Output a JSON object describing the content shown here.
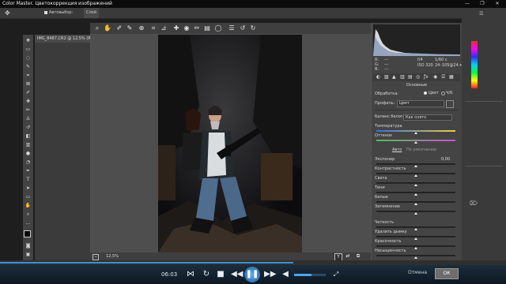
{
  "window": {
    "title": "Color Master. Цветокоррекция изображений",
    "controls": [
      "—",
      "❐",
      "✕"
    ]
  },
  "optbar": {
    "items": [
      "Автовыбор:",
      "Слой"
    ]
  },
  "doc_tab": {
    "label": "IMG_8487.CR2 @ 12,5% (RGB/8)"
  },
  "dialog": {
    "zoom": "12,5%",
    "toolbar_icons": [
      "zoom-icon",
      "hand-icon",
      "white-balance-icon",
      "color-sampler-icon",
      "target-adjust-icon",
      "crop-icon",
      "straighten-icon",
      "spot-removal-icon",
      "redeye-icon",
      "adjustment-brush-icon",
      "graduated-filter-icon",
      "radial-filter-icon",
      "preferences-icon",
      "rotate-ccw-icon",
      "rotate-cw-icon"
    ],
    "histogram_info": {
      "r": "R:",
      "g": "G:",
      "b": "B:",
      "dash": "---",
      "aperture": "f/4",
      "shutter": "1/60 с",
      "iso": "ISO 320",
      "lens": "24–105@24 мм"
    },
    "panel_title": "Основные",
    "processing_label": "Обработка:",
    "processing_color": "Цвет",
    "processing_bw": "Ч/Б",
    "profile_label": "Профиль:",
    "profile_value": "Цвет",
    "wb_label": "Баланс белого:",
    "wb_value": "Как снято",
    "sliders": [
      {
        "label": "Температура",
        "value": "",
        "pos": 0.5
      },
      {
        "label": "Оттенок",
        "value": "",
        "pos": 0.5
      },
      {
        "label": "Экспонир",
        "value": "0,00",
        "pos": 0.5
      },
      {
        "label": "Контрастность",
        "value": "",
        "pos": 0.5
      },
      {
        "label": "Света",
        "value": "",
        "pos": 0.5
      },
      {
        "label": "Тени",
        "value": "",
        "pos": 0.5
      },
      {
        "label": "Белые",
        "value": "",
        "pos": 0.5
      },
      {
        "label": "Затемнение",
        "value": "",
        "pos": 0.5
      },
      {
        "label": "Четкость",
        "value": "",
        "pos": 0.5
      },
      {
        "label": "Удалить дымку",
        "value": "",
        "pos": 0.5
      },
      {
        "label": "Красочность",
        "value": "",
        "pos": 0.5
      },
      {
        "label": "Насыщенность",
        "value": "",
        "pos": 0.5
      }
    ],
    "auto_label": "Авто",
    "default_label": "По умолчанию",
    "cancel": "Отмена",
    "ok": "ОК"
  },
  "player": {
    "time": "06:03",
    "progress": 0.58,
    "volume": 0.55,
    "accent": "#3d8fd6"
  }
}
